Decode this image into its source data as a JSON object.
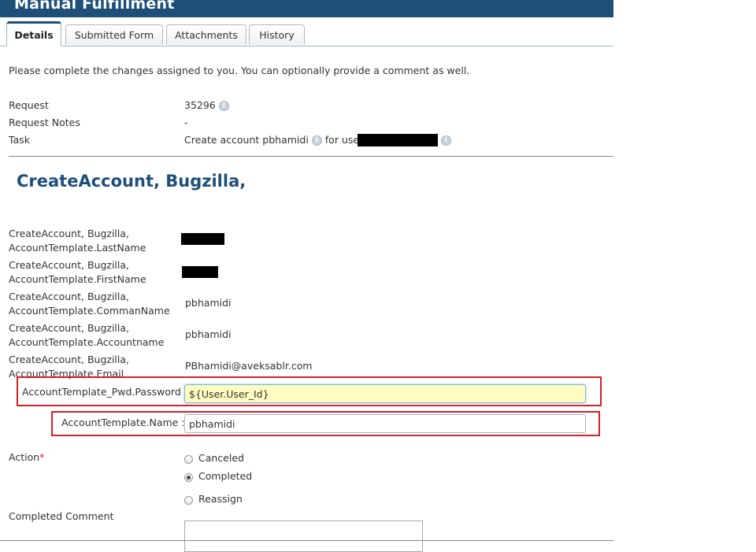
{
  "window": {
    "title": "Manual Fulfillment"
  },
  "tabs": [
    {
      "label": "Details",
      "active": true
    },
    {
      "label": "Submitted Form",
      "active": false
    },
    {
      "label": "Attachments",
      "active": false
    },
    {
      "label": "History",
      "active": false
    }
  ],
  "intro": "Please complete the changes assigned to you. You can optionally provide a comment as well.",
  "summary": {
    "request_label": "Request",
    "request_value": "35296",
    "notes_label": "Request Notes",
    "notes_value": "-",
    "task_label": "Task",
    "task_prefix": "Create account pbhamidi",
    "task_mid": "for user"
  },
  "section": {
    "title": "CreateAccount, Bugzilla,"
  },
  "attributes": [
    {
      "label": "CreateAccount, Bugzilla, AccountTemplate.LastName",
      "value": ""
    },
    {
      "label": "CreateAccount, Bugzilla, AccountTemplate.FirstName",
      "value": ""
    },
    {
      "label": "CreateAccount, Bugzilla, AccountTemplate.CommanName",
      "value": "pbhamidi"
    },
    {
      "label": "CreateAccount, Bugzilla, AccountTemplate.Accountname",
      "value": "pbhamidi"
    },
    {
      "label": "CreateAccount, Bugzilla, AccountTemplate.Email",
      "value": "PBhamidi@aveksablr.com"
    }
  ],
  "inputs": {
    "password_label": "AccountTemplate_Pwd.Password :",
    "password_value": "${User.User_Id}",
    "name_label": "AccountTemplate.Name :",
    "name_value": "pbhamidi"
  },
  "action": {
    "label": "Action",
    "required_mark": "*",
    "options": [
      {
        "label": "Canceled",
        "selected": false
      },
      {
        "label": "Completed",
        "selected": true
      },
      {
        "label": "Reassign",
        "selected": false
      }
    ]
  },
  "comment": {
    "label": "Completed Comment",
    "value": ""
  },
  "colors": {
    "brand": "#1d4f79",
    "highlight_box": "#d4202a",
    "focus_input": "#fdfdc0"
  }
}
